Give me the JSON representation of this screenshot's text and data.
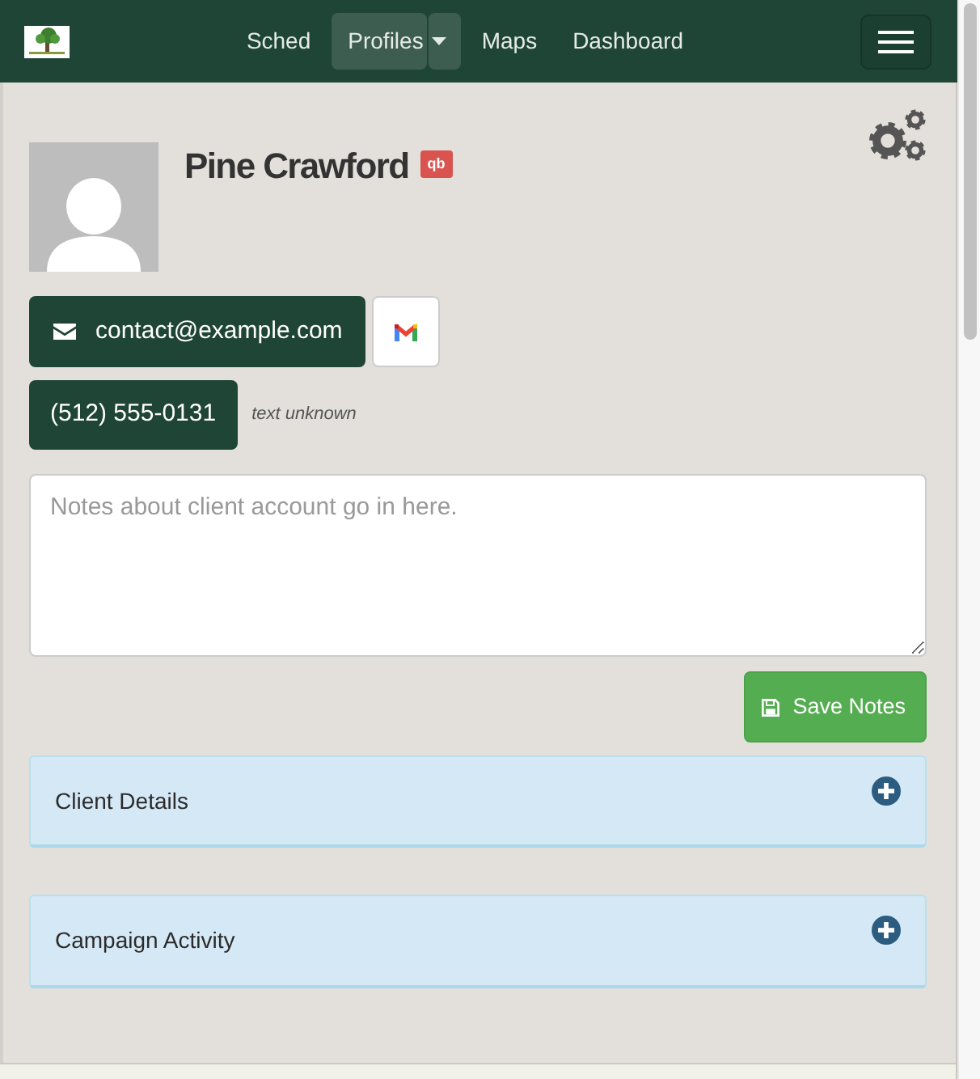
{
  "navbar": {
    "items": [
      {
        "label": "Sched",
        "kind": "link",
        "selected": false
      },
      {
        "label": "Profiles",
        "kind": "dropdown",
        "selected": true
      },
      {
        "label": "Maps",
        "kind": "link",
        "selected": false
      },
      {
        "label": "Dashboard",
        "kind": "link",
        "selected": false
      }
    ]
  },
  "profile": {
    "name": "Pine Crawford",
    "badge": "qb",
    "email": "contact@example.com",
    "phone": "(512) 555-0131",
    "phone_note": "text unknown"
  },
  "notes": {
    "placeholder": "Notes about client account go in here.",
    "save_button": "Save Notes"
  },
  "panels": [
    {
      "title": "Client Details",
      "expanded": false
    },
    {
      "title": "Campaign Activity",
      "expanded": false
    }
  ]
}
